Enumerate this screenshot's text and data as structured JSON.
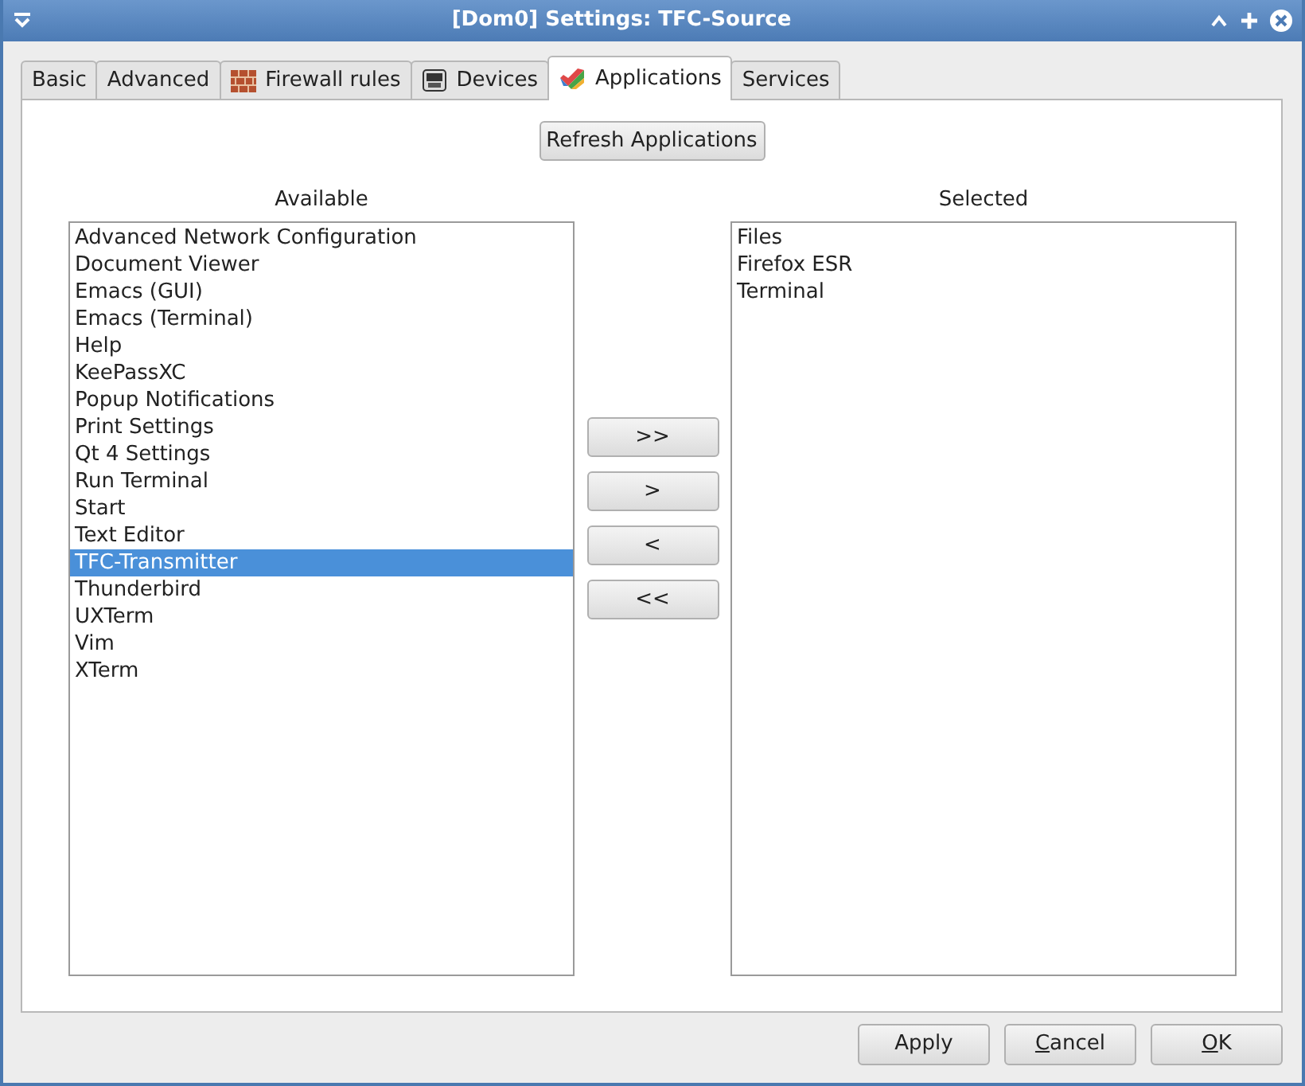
{
  "window": {
    "title": "[Dom0] Settings: TFC-Source"
  },
  "tabs": [
    {
      "label": "Basic",
      "kind": "plain",
      "selected": false
    },
    {
      "label": "Advanced",
      "kind": "plain",
      "selected": false
    },
    {
      "label": "Firewall rules",
      "kind": "firewall",
      "selected": false
    },
    {
      "label": "Devices",
      "kind": "devices",
      "selected": false
    },
    {
      "label": "Applications",
      "kind": "applications",
      "selected": true
    },
    {
      "label": "Services",
      "kind": "plain",
      "selected": false
    }
  ],
  "refresh_button": "Refresh Applications",
  "available": {
    "label": "Available",
    "items": [
      {
        "label": "Advanced Network Configuration",
        "selected": false
      },
      {
        "label": "Document Viewer",
        "selected": false
      },
      {
        "label": "Emacs (GUI)",
        "selected": false
      },
      {
        "label": "Emacs (Terminal)",
        "selected": false
      },
      {
        "label": "Help",
        "selected": false
      },
      {
        "label": "KeePassXC",
        "selected": false
      },
      {
        "label": "Popup Notifications",
        "selected": false
      },
      {
        "label": "Print Settings",
        "selected": false
      },
      {
        "label": "Qt 4 Settings",
        "selected": false
      },
      {
        "label": "Run Terminal",
        "selected": false
      },
      {
        "label": "Start",
        "selected": false
      },
      {
        "label": "Text Editor",
        "selected": false
      },
      {
        "label": "TFC-Transmitter",
        "selected": true
      },
      {
        "label": "Thunderbird",
        "selected": false
      },
      {
        "label": "UXTerm",
        "selected": false
      },
      {
        "label": "Vim",
        "selected": false
      },
      {
        "label": "XTerm",
        "selected": false
      }
    ]
  },
  "move_buttons": [
    ">>",
    ">",
    "<",
    "<<"
  ],
  "selected_list": {
    "label": "Selected",
    "items": [
      {
        "label": "Files",
        "selected": false
      },
      {
        "label": "Firefox ESR",
        "selected": false
      },
      {
        "label": "Terminal",
        "selected": false
      }
    ]
  },
  "dialog_buttons": [
    {
      "label": "Apply",
      "mnemonic_underlined": false
    },
    {
      "label": "Cancel",
      "mnemonic_underlined": true
    },
    {
      "label": "OK",
      "mnemonic_underlined": true
    }
  ]
}
